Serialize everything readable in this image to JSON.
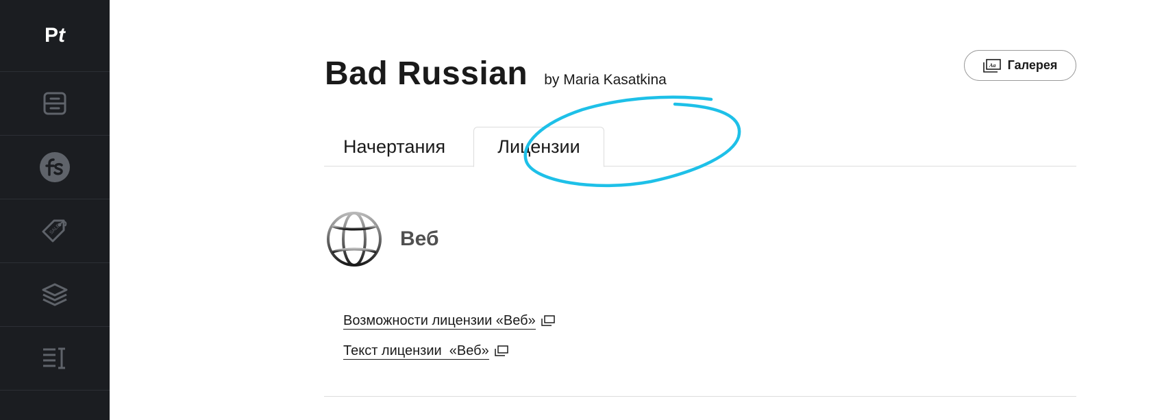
{
  "sidebar": {
    "logo": {
      "main": "P",
      "accent": "t"
    },
    "items": [
      {
        "icon": "catalog-icon"
      },
      {
        "icon": "fontstore-icon"
      },
      {
        "icon": "sale-tag-icon"
      },
      {
        "icon": "layers-icon"
      },
      {
        "icon": "text-cursor-icon"
      }
    ]
  },
  "header": {
    "title": "Bad Russian",
    "author": "by Maria Kasatkina",
    "gallery_label": "Галерея"
  },
  "tabs": [
    {
      "label": "Начертания",
      "active": false
    },
    {
      "label": "Лицензии",
      "active": true
    }
  ],
  "license": {
    "icon": "globe-icon",
    "title": "Веб",
    "links": [
      {
        "label": "Возможности лицензии «Веб»"
      },
      {
        "label": "Текст лицензии  «Веб»"
      }
    ]
  },
  "colors": {
    "sidebar_bg": "#1b1d21",
    "annotation": "#1ec0e8",
    "icon_gray": "#5f636a"
  }
}
